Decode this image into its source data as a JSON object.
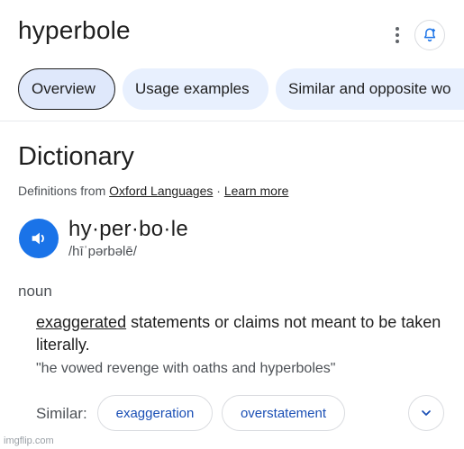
{
  "header": {
    "title": "hyperbole",
    "more_icon": "more-vert-icon",
    "alert_icon": "bell-add-icon"
  },
  "tabs": [
    {
      "label": "Overview",
      "active": true
    },
    {
      "label": "Usage examples",
      "active": false
    },
    {
      "label": "Similar and opposite wo",
      "active": false
    }
  ],
  "dictionary": {
    "title": "Dictionary",
    "source_prefix": "Definitions from ",
    "source_name": "Oxford Languages",
    "separator": " · ",
    "learn_more": "Learn more",
    "headword": "hy·per·bo·le",
    "phonetic": "/hīˈpərbəlē/",
    "speaker_icon": "volume-icon",
    "part_of_speech": "noun",
    "definition_link": "exaggerated",
    "definition_rest": " statements or claims not meant to be taken literally.",
    "example": "\"he vowed revenge with oaths and hyperboles\"",
    "similar_label": "Similar:",
    "similar": [
      "exaggeration",
      "overstatement"
    ],
    "expand_icon": "chevron-down-icon"
  },
  "watermark": "imgflip.com",
  "colors": {
    "accent": "#1a73e8",
    "chip_text": "#1a4fb5",
    "tab_bg": "#e8f0fe"
  }
}
